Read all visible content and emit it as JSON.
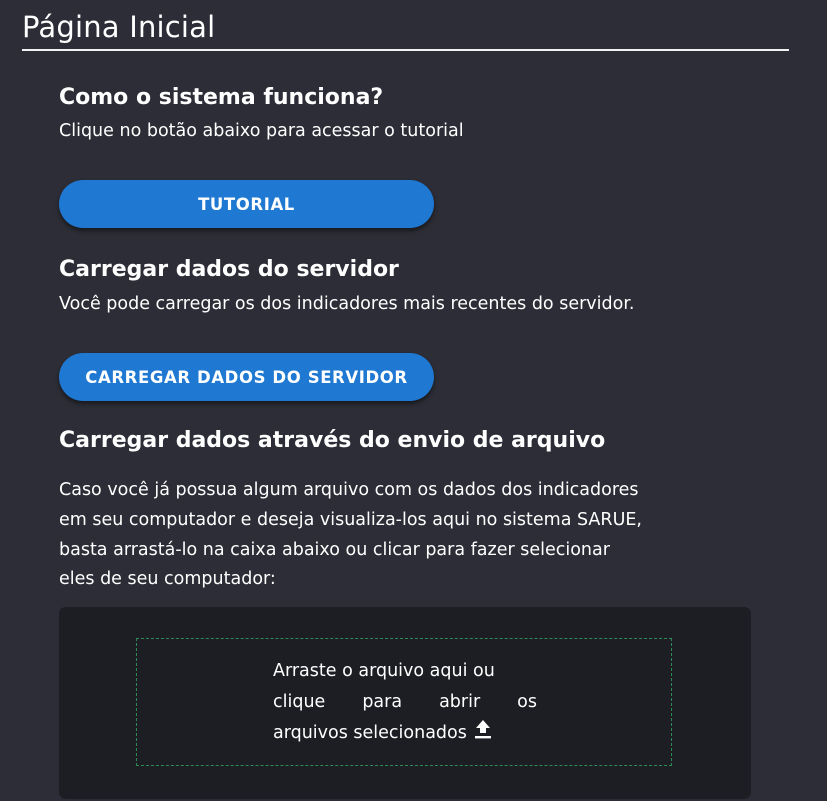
{
  "header": {
    "title": "Página Inicial"
  },
  "tutorial_section": {
    "heading": "Como o sistema funciona?",
    "description": "Clique no botão abaixo para acessar o tutorial",
    "button_label": "TUTORIAL"
  },
  "server_section": {
    "heading": "Carregar dados do servidor",
    "description": "Você pode carregar os dos indicadores mais recentes do servidor.",
    "button_label": "CARREGAR DADOS DO SERVIDOR"
  },
  "upload_section": {
    "heading": "Carregar dados através do envio de arquivo",
    "description_lines": [
      "Caso você já possua algum arquivo com os dados dos indicadores",
      "em seu computador e deseja visualiza-los aqui no sistema SARUE,",
      "basta arrastá-lo na caixa abaixo ou clicar para fazer selecionar",
      "eles de seu computador:"
    ],
    "dropzone": {
      "line1": "Arraste o arquivo aqui ou",
      "line2_words": [
        "clique",
        "para",
        "abrir",
        "os"
      ],
      "line3": "arquivos selecionados",
      "icon": "upload-icon"
    }
  },
  "colors": {
    "background": "#2c2d36",
    "button": "#1f78d1",
    "panel": "#1c1e24",
    "dropzone_border": "#2e8b57",
    "text": "#ffffff"
  }
}
